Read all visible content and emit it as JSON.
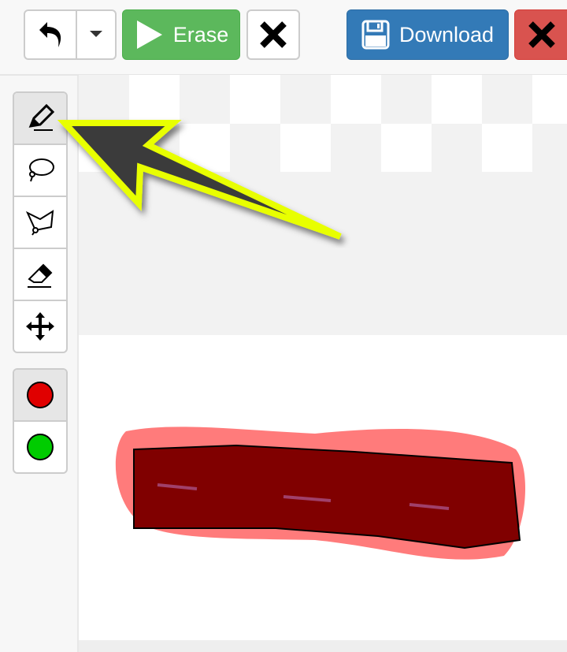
{
  "toolbar": {
    "undo_icon": "undo-icon",
    "dropdown_icon": "caret-down-icon",
    "erase_label": "Erase",
    "download_label": "Download"
  },
  "tools": [
    {
      "name": "pen",
      "active": true
    },
    {
      "name": "lasso"
    },
    {
      "name": "polygon-lasso"
    },
    {
      "name": "eraser"
    },
    {
      "name": "move"
    }
  ],
  "colors": [
    {
      "color": "#e00000",
      "active": true
    },
    {
      "color": "#00cc00"
    }
  ],
  "accent": {
    "success": "#5cb85c",
    "primary": "#337ab7",
    "danger": "#d9534f",
    "arrow": "#e8ff00"
  }
}
